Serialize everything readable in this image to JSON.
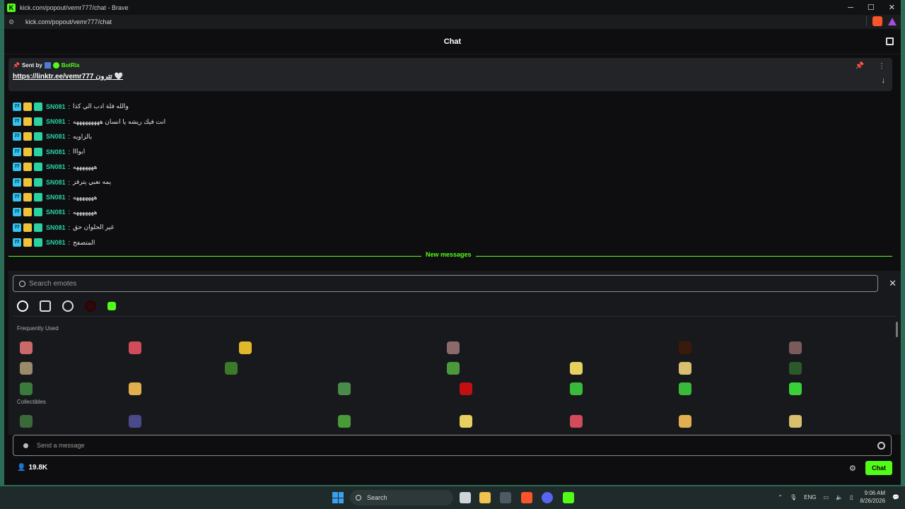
{
  "window": {
    "title": "kick.com/popout/vemr777/chat - Brave",
    "url": "kick.com/popout/vemr777/chat",
    "controls": [
      "─",
      "☐",
      "✕"
    ]
  },
  "chat": {
    "title": "Chat",
    "pinned": {
      "sent_by_label": "Sent by",
      "sender": "BotRix",
      "message": "https://linktr.ee/vemr777 تترون 🤍"
    },
    "messages": [
      {
        "user": "SN081",
        "text": "والله فلة ادب الي كذا"
      },
      {
        "user": "SN081",
        "text": "انت فيك ريشه يا انسان هههههههههه"
      },
      {
        "user": "SN081",
        "text": "بالزاويه"
      },
      {
        "user": "SN081",
        "text": "ابوااا"
      },
      {
        "user": "SN081",
        "text": "هههههههه"
      },
      {
        "user": "SN081",
        "text": "يمه نعبي يترفز"
      },
      {
        "user": "SN081",
        "text": "هههههههه"
      },
      {
        "user": "SN081",
        "text": "هههههههه"
      },
      {
        "user": "SN081",
        "text": "غير الحلوان حق"
      },
      {
        "user": "SN081",
        "text": "المتصفح"
      }
    ],
    "badge_sub_text": "77",
    "new_messages_label": "New messages",
    "emote_picker": {
      "search_placeholder": "Search emotes",
      "sections": [
        "Frequently Used",
        "Collectibles"
      ]
    },
    "input_placeholder": "Send a message",
    "viewers": "19.8K",
    "chat_button": "Chat"
  },
  "taskbar": {
    "search_label": "Search",
    "language": "ENG",
    "time": "9:06 AM",
    "date": "8/26/2026"
  },
  "colors": {
    "accent": "#53fc18",
    "username": "#2ad1a3"
  }
}
